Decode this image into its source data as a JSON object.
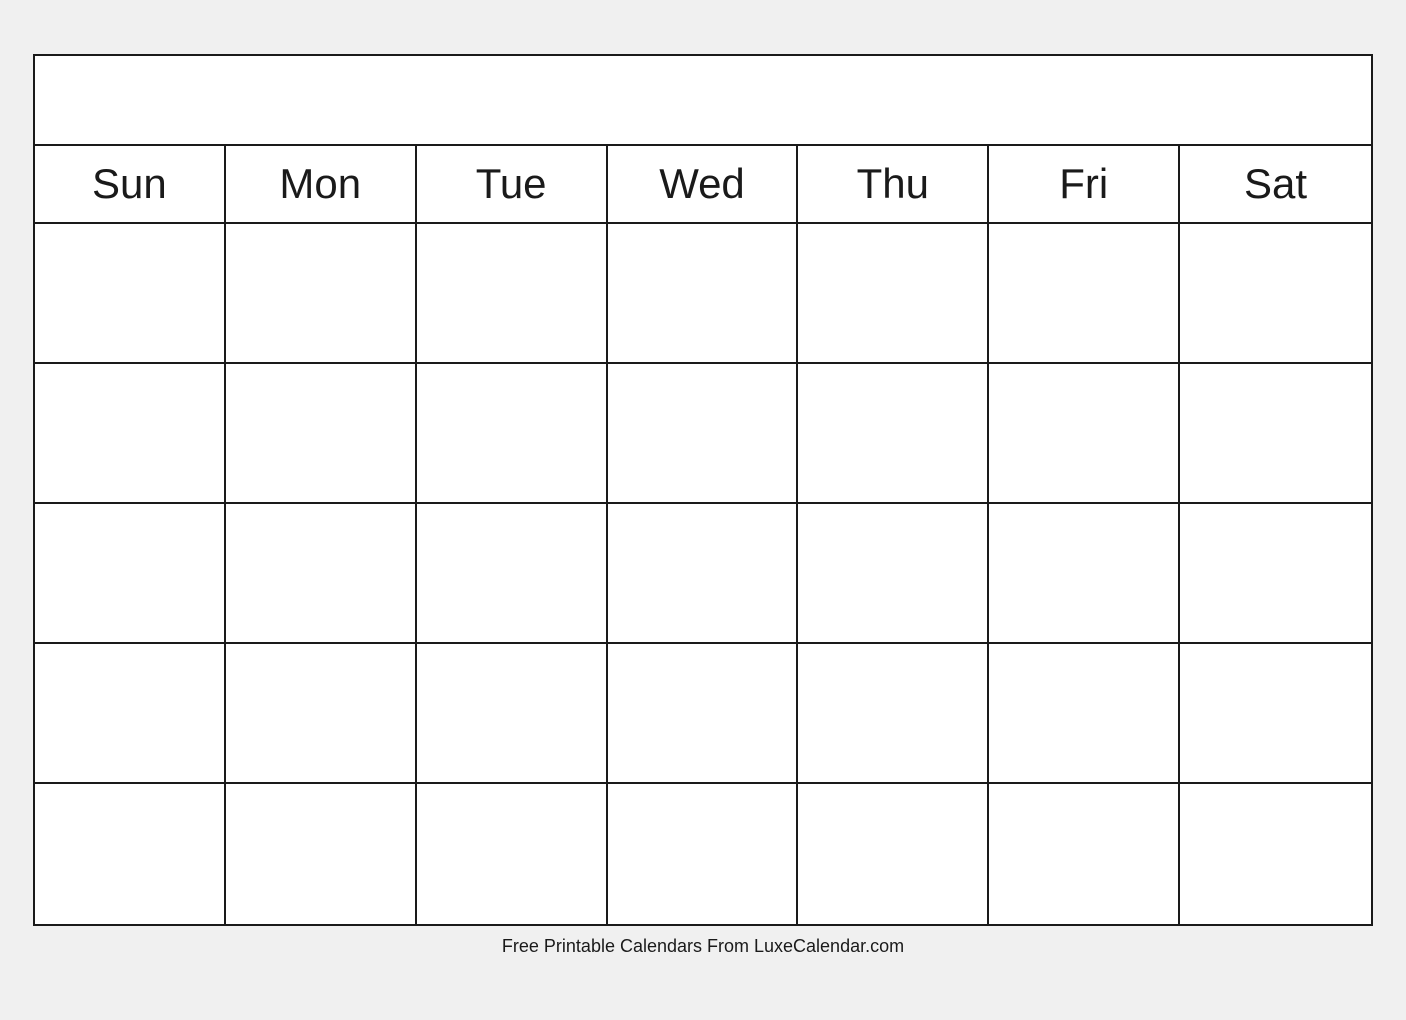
{
  "calendar": {
    "days": [
      "Sun",
      "Mon",
      "Tue",
      "Wed",
      "Thu",
      "Fri",
      "Sat"
    ],
    "weeks": 5
  },
  "footer": {
    "text": "Free Printable Calendars From LuxeCalendar.com"
  }
}
